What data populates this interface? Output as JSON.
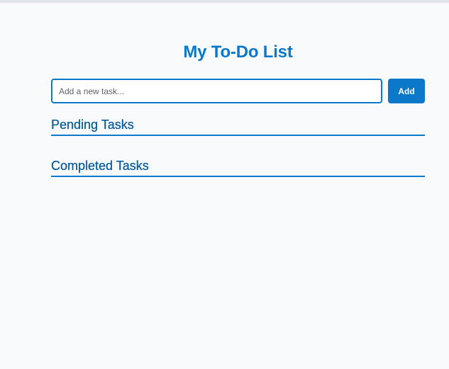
{
  "app": {
    "title": "My To-Do List"
  },
  "input": {
    "value": "",
    "placeholder": "Add a new task..."
  },
  "buttons": {
    "add_label": "Add"
  },
  "sections": {
    "pending": {
      "title": "Pending Tasks",
      "tasks": []
    },
    "completed": {
      "title": "Completed Tasks",
      "tasks": []
    }
  },
  "colors": {
    "accent": "#0b78c9",
    "section_heading": "#0b5e9e",
    "background": "#f8fafc"
  }
}
